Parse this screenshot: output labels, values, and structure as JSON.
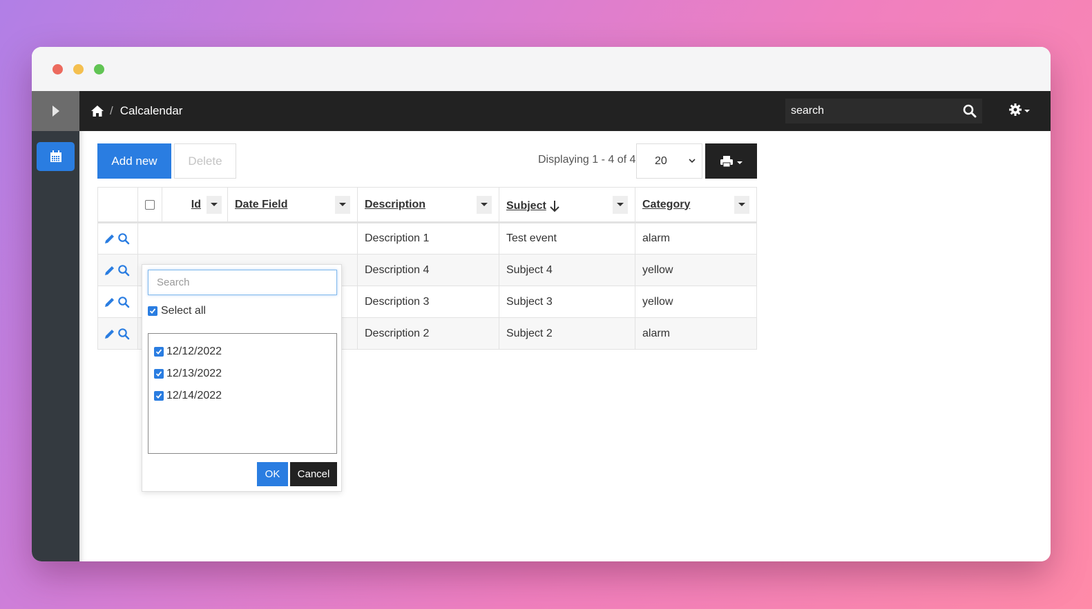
{
  "window": {
    "controls": [
      "close",
      "minimize",
      "maximize"
    ]
  },
  "navbar": {
    "breadcrumb": {
      "home_icon": "home-icon",
      "separator": "/",
      "current": "Calcalendar"
    },
    "search": {
      "value": "search",
      "placeholder": "search"
    },
    "settings_icon": "gear-icon"
  },
  "sidebar": {
    "toggle_icon": "caret-right-icon",
    "items": [
      {
        "icon": "calendar-icon",
        "active": true
      }
    ]
  },
  "toolbar": {
    "add_label": "Add new",
    "delete_label": "Delete",
    "displaying": "Displaying 1 - 4 of 4",
    "per_page": "20",
    "print_icon": "print-icon"
  },
  "table": {
    "columns": [
      {
        "key": "id",
        "label": "Id"
      },
      {
        "key": "date",
        "label": "Date Field"
      },
      {
        "key": "description",
        "label": "Description"
      },
      {
        "key": "subject",
        "label": "Subject",
        "sort": "descending"
      },
      {
        "key": "category",
        "label": "Category"
      }
    ],
    "rows": [
      {
        "description": "Description 1",
        "subject": "Test event",
        "category": "alarm"
      },
      {
        "description": "Description 4",
        "subject": "Subject 4",
        "category": "yellow"
      },
      {
        "description": "Description 3",
        "subject": "Subject 3",
        "category": "yellow"
      },
      {
        "description": "Description 2",
        "subject": "Subject 2",
        "category": "alarm"
      }
    ]
  },
  "filter_popup": {
    "search_placeholder": "Search",
    "search_value": "",
    "select_all_label": "Select all",
    "select_all_checked": true,
    "values": [
      {
        "label": "12/12/2022",
        "checked": true
      },
      {
        "label": "12/13/2022",
        "checked": true
      },
      {
        "label": "12/14/2022",
        "checked": true
      }
    ],
    "ok_label": "OK",
    "cancel_label": "Cancel"
  },
  "colors": {
    "primary": "#2a7de1",
    "navbar": "#222222",
    "sidebar": "#343a40"
  }
}
